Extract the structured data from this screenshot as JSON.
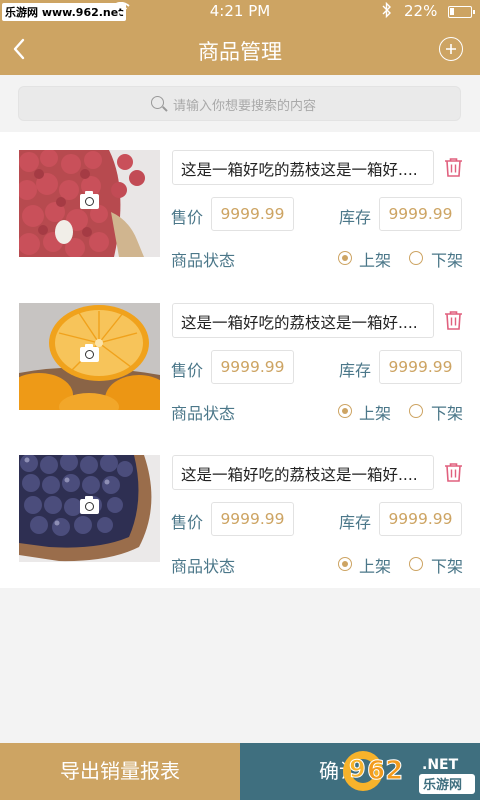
{
  "status_bar": {
    "carrier": "乐游网 www.962.net",
    "time": "4:21 PM",
    "battery_percent": "22%",
    "battery_level": 0.22,
    "icons": [
      "wifi-icon",
      "bluetooth-icon",
      "battery-icon"
    ]
  },
  "nav": {
    "back_icon": "chevron-left-icon",
    "title": "商品管理",
    "add_icon": "plus-circle-icon"
  },
  "search": {
    "placeholder": "请输入你想要搜索的内容",
    "icon": "search-icon"
  },
  "labels": {
    "price": "售价",
    "stock": "库存",
    "status": "商品状态",
    "on_shelf": "上架",
    "off_shelf": "下架"
  },
  "products": [
    {
      "image": "lychee",
      "name": "这是一箱好吃的荔枝这是一箱好....",
      "price": "9999.99",
      "stock": "9999.99",
      "status": "上架"
    },
    {
      "image": "orange",
      "name": "这是一箱好吃的荔枝这是一箱好....",
      "price": "9999.99",
      "stock": "9999.99",
      "status": "上架"
    },
    {
      "image": "blueberry",
      "name": "这是一箱好吃的荔枝这是一箱好....",
      "price": "9999.99",
      "stock": "9999.99",
      "status": "上架"
    }
  ],
  "bottom": {
    "export_label": "导出销量报表",
    "confirm_label": "确认"
  },
  "watermark": {
    "text_962": "962",
    "net": ".NET",
    "cn": "乐游网"
  },
  "colors": {
    "brand": "#cda463",
    "accent_dark": "#3f6f7f",
    "label_text": "#4b7789",
    "delete": "#e0607e"
  }
}
